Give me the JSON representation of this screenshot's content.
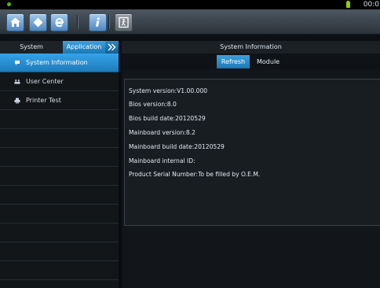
{
  "status_bar": {
    "clock": "00:0",
    "battery_icon": "battery-icon"
  },
  "toolbar": {
    "buttons": [
      "home-icon",
      "diamond-icon",
      "browser-icon",
      "info-icon",
      "exit-icon"
    ]
  },
  "sidebar": {
    "tabs": [
      {
        "label": "System"
      },
      {
        "label": "Application"
      }
    ],
    "items": [
      {
        "label": "System Information",
        "icon": "chat-icon",
        "active": true
      },
      {
        "label": "User Center",
        "icon": "users-icon",
        "active": false
      },
      {
        "label": "Printer Test",
        "icon": "printer-icon",
        "active": false
      }
    ]
  },
  "main": {
    "title": "System Information",
    "tabs": [
      {
        "label": "Refresh"
      },
      {
        "label": "Module"
      }
    ],
    "info_lines": [
      "System version:V1.00.000",
      "Bios version:8.0",
      "Bios build date:20120529",
      "Mainboard version:8.2",
      "Mainboard build date:20120529",
      "Mainboard internal ID:",
      "Product Serial Number:To be filled by O.E.M."
    ]
  },
  "colors": {
    "accent": "#2a8fd2",
    "background": "#12161a"
  }
}
